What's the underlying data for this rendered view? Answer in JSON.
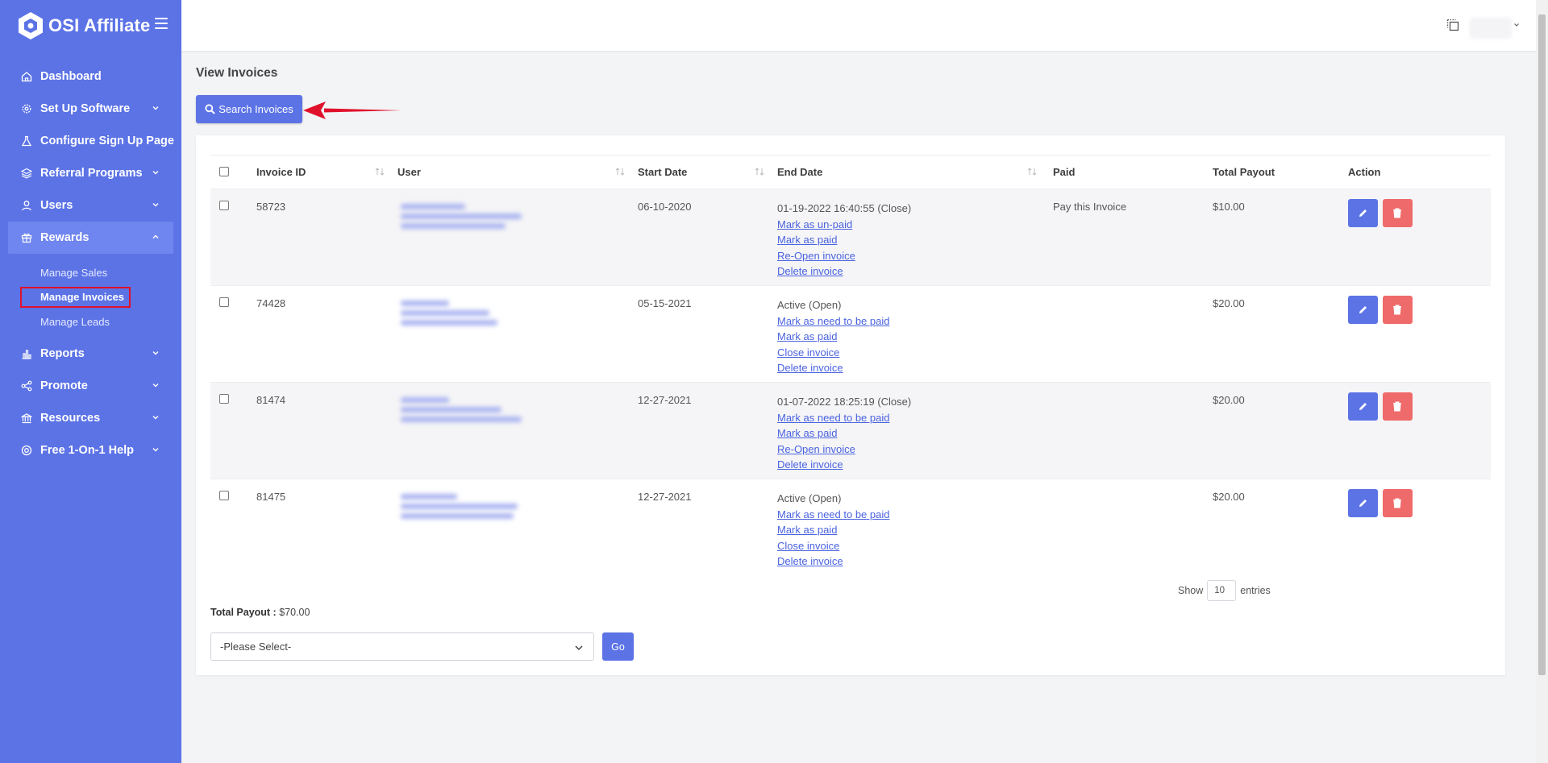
{
  "app": {
    "brand": "OSI Affiliate"
  },
  "sidebar": {
    "items": [
      {
        "label": "Dashboard",
        "icon": "home-icon"
      },
      {
        "label": "Set Up Software",
        "icon": "gear-icon"
      },
      {
        "label": "Configure Sign Up Page",
        "icon": "flask-icon"
      },
      {
        "label": "Referral Programs",
        "icon": "layers-icon"
      },
      {
        "label": "Users",
        "icon": "user-icon"
      },
      {
        "label": "Rewards",
        "icon": "gift-icon"
      },
      {
        "label": "Reports",
        "icon": "bar-chart-icon"
      },
      {
        "label": "Promote",
        "icon": "share-icon"
      },
      {
        "label": "Resources",
        "icon": "bank-icon"
      },
      {
        "label": "Free 1-On-1 Help",
        "icon": "lifebuoy-icon"
      }
    ],
    "rewards_sub": [
      "Manage Sales",
      "Manage Invoices",
      "Manage Leads"
    ]
  },
  "page": {
    "title": "View Invoices",
    "search_button": "Search Invoices"
  },
  "table": {
    "headers": [
      "Invoice ID",
      "User",
      "Start Date",
      "End Date",
      "Paid",
      "Total Payout",
      "Action"
    ],
    "rows": [
      {
        "id": "58723",
        "start": "06-10-2020",
        "end_status": "01-19-2022 16:40:55 (Close)",
        "links": [
          "Mark as un-paid",
          "Mark as paid",
          "Re-Open invoice",
          "Delete invoice"
        ],
        "paid": "Pay this Invoice",
        "payout": "$10.00"
      },
      {
        "id": "74428",
        "start": "05-15-2021",
        "end_status": "Active (Open)",
        "links": [
          "Mark as need to be paid",
          "Mark as paid",
          "Close invoice",
          "Delete invoice"
        ],
        "paid": "",
        "payout": "$20.00"
      },
      {
        "id": "81474",
        "start": "12-27-2021",
        "end_status": "01-07-2022 18:25:19 (Close)",
        "links": [
          "Mark as need to be paid",
          "Mark as paid",
          "Re-Open invoice",
          "Delete invoice"
        ],
        "paid": "",
        "payout": "$20.00"
      },
      {
        "id": "81475",
        "start": "12-27-2021",
        "end_status": "Active (Open)",
        "links": [
          "Mark as need to be paid",
          "Mark as paid",
          "Close invoice",
          "Delete invoice"
        ],
        "paid": "",
        "payout": "$20.00"
      }
    ]
  },
  "footer": {
    "show_label": "Show",
    "entries_value": "10",
    "entries_label": "entries",
    "total_label": "Total Payout :",
    "total_value": "$70.00",
    "select_value": "-Please Select-",
    "go_label": "Go"
  },
  "colors": {
    "primary": "#5c73e6",
    "danger": "#ef6a6a",
    "link": "#4a63e0",
    "highlight": "#e0112b"
  }
}
